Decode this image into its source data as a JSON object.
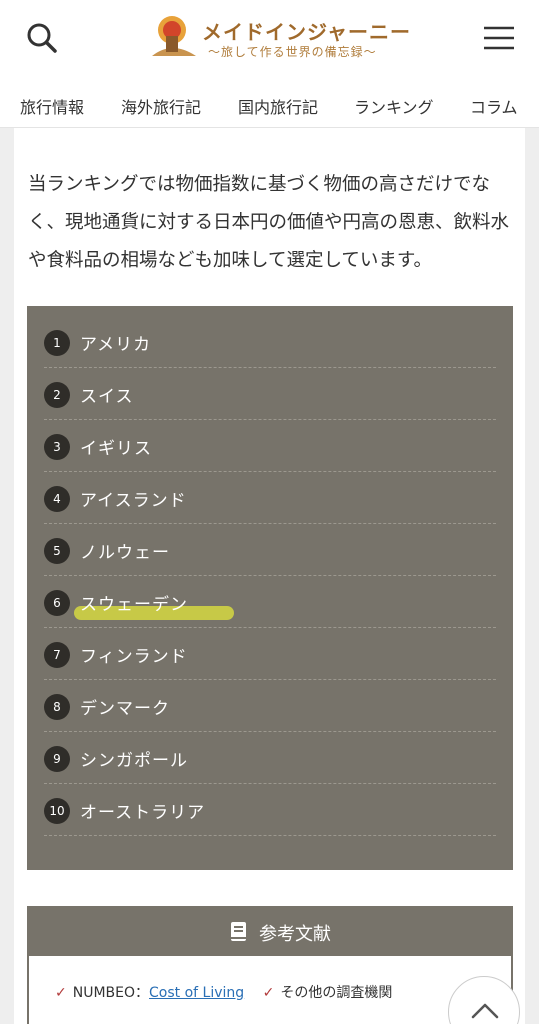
{
  "header": {
    "logo_title": "メイドインジャーニー",
    "logo_subtitle": "〜旅して作る世界の備忘録〜",
    "nav": [
      "旅行情報",
      "海外旅行記",
      "国内旅行記",
      "ランキング",
      "コラム"
    ]
  },
  "intro_text": "当ランキングでは物価指数に基づく物価の高さだけでなく、現地通貨に対する日本円の価値や円高の恩恵、飲料水や食料品の相場なども加味して選定しています。",
  "ranking": [
    {
      "num": "1",
      "label": "アメリカ"
    },
    {
      "num": "2",
      "label": "スイス"
    },
    {
      "num": "3",
      "label": "イギリス"
    },
    {
      "num": "4",
      "label": "アイスランド"
    },
    {
      "num": "5",
      "label": "ノルウェー"
    },
    {
      "num": "6",
      "label": "スウェーデン"
    },
    {
      "num": "7",
      "label": "フィンランド"
    },
    {
      "num": "8",
      "label": "デンマーク"
    },
    {
      "num": "9",
      "label": "シンガポール"
    },
    {
      "num": "10",
      "label": "オーストラリア"
    }
  ],
  "references": {
    "title": "参考文献",
    "item1_prefix": "NUMBEO：",
    "item1_link": "Cost of Living",
    "item2": "その他の調査機関"
  },
  "colors": {
    "ranking_bg": "#77736a",
    "highlight": "#e2e63c",
    "check": "#b23b3b",
    "link": "#2a6fb5"
  }
}
